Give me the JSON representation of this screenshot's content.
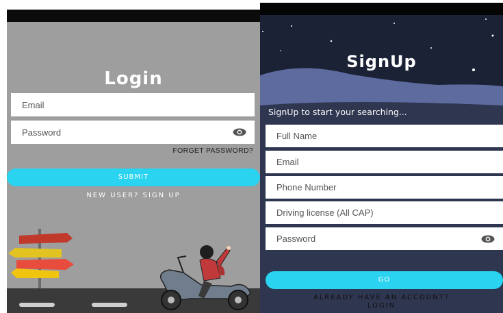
{
  "login": {
    "title": "Login",
    "email_placeholder": "Email",
    "password_placeholder": "Password",
    "forgot_label": "FORGET PASSWORD?",
    "submit_label": "SUBMIT",
    "new_user_label": "NEW USER? SIGN UP"
  },
  "signup": {
    "title": "SignUp",
    "tagline": "SignUp to start your searching...",
    "fields": [
      {
        "placeholder": "Full Name"
      },
      {
        "placeholder": "Email"
      },
      {
        "placeholder": "Phone Number"
      },
      {
        "placeholder": "Driving license (All CAP)"
      },
      {
        "placeholder": "Password"
      }
    ],
    "go_label": "GO",
    "already_label_1": "ALREADY HAVE AN ACCOUNT?",
    "already_label_2": "LOGIN"
  },
  "colors": {
    "login_bg": "#9e9e9e",
    "signup_bg": "#1d2338",
    "accent": "#2ad3ef"
  },
  "icons": [
    "eye-icon",
    "signpost-illustration",
    "scooter-rider-illustration",
    "moon-icon"
  ]
}
